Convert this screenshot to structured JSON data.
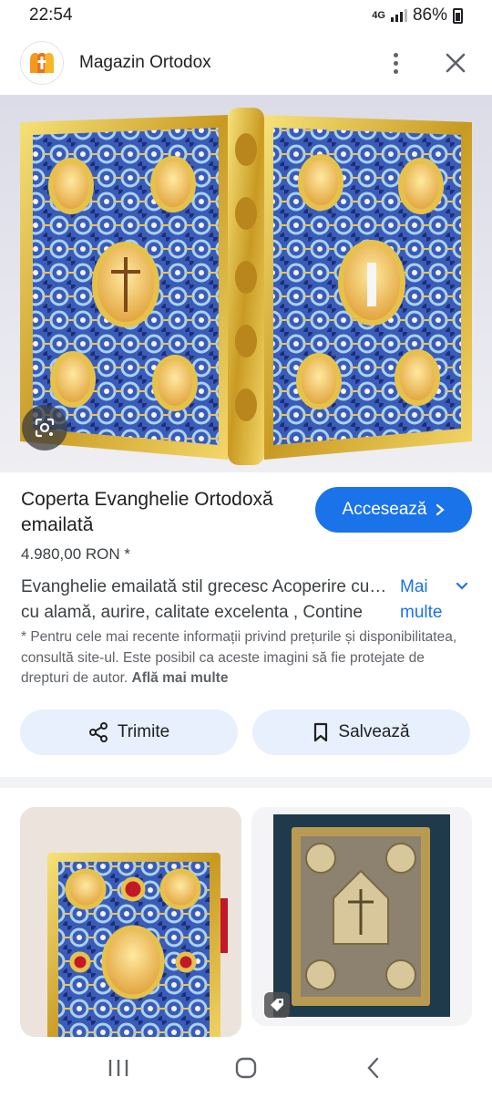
{
  "status": {
    "time": "22:54",
    "network": "4G",
    "battery": "86%"
  },
  "header": {
    "site_name": "Magazin Ortodox"
  },
  "product": {
    "title": "Coperta Evanghelie Ortodoxă emailată",
    "visit_label": "Accesează",
    "price": "4.980,00 RON *",
    "description_line1": "Evanghelie emailată stil grecesc Acoperire cu…",
    "description_line2": "cu alamă, aurire, calitate excelenta , Contine",
    "more_label": "Mai multe",
    "disclaimer": "* Pentru cele mai recente informații privind prețurile și disponibilitatea, consultă site-ul. Este posibil ca aceste imagini să fie protejate de drepturi de autor.",
    "learn_more": "Află mai multe"
  },
  "actions": {
    "share_label": "Trimite",
    "save_label": "Salvează"
  },
  "colors": {
    "accent": "#1a73e8",
    "pill_bg": "#e8f0fe",
    "gold": "#d4af37",
    "enamel_blue": "#2d4fa8"
  },
  "icons": [
    "lens-icon",
    "share-icon",
    "bookmark-icon",
    "tag-icon",
    "recents-icon",
    "home-icon",
    "back-icon"
  ]
}
